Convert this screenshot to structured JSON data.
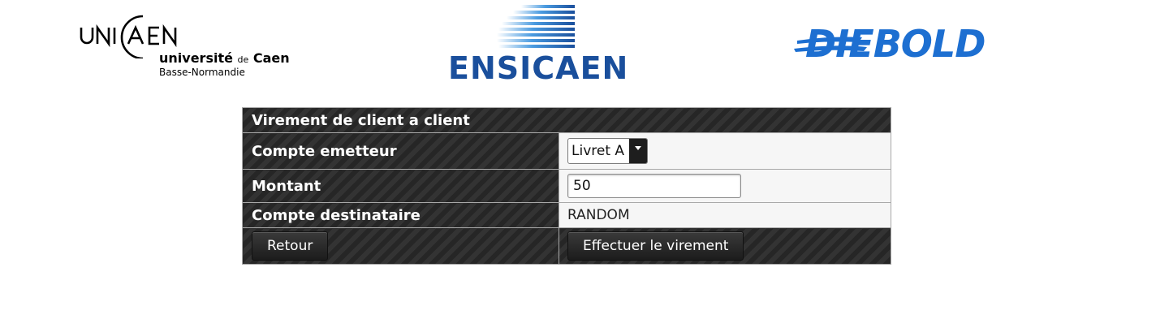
{
  "logos": {
    "unicaen": {
      "mark": "UNIC∆EN",
      "line1_main": "université",
      "line1_small": "de",
      "line1_end": "Caen",
      "line2": "Basse-Normandie"
    },
    "ensicaen": {
      "text": "ENSICAEN",
      "color": "#1a4f9c"
    },
    "diebold": {
      "text": "DIEBOLD",
      "color": "#1d6fd1"
    }
  },
  "transfer": {
    "title": "Virement de client a client",
    "source_account": {
      "label": "Compte emetteur",
      "selected": "Livret A"
    },
    "amount": {
      "label": "Montant",
      "value": "50"
    },
    "destination_account": {
      "label": "Compte destinataire",
      "value": "RANDOM"
    },
    "actions": {
      "back_label": "Retour",
      "submit_label": "Effectuer le virement"
    }
  }
}
